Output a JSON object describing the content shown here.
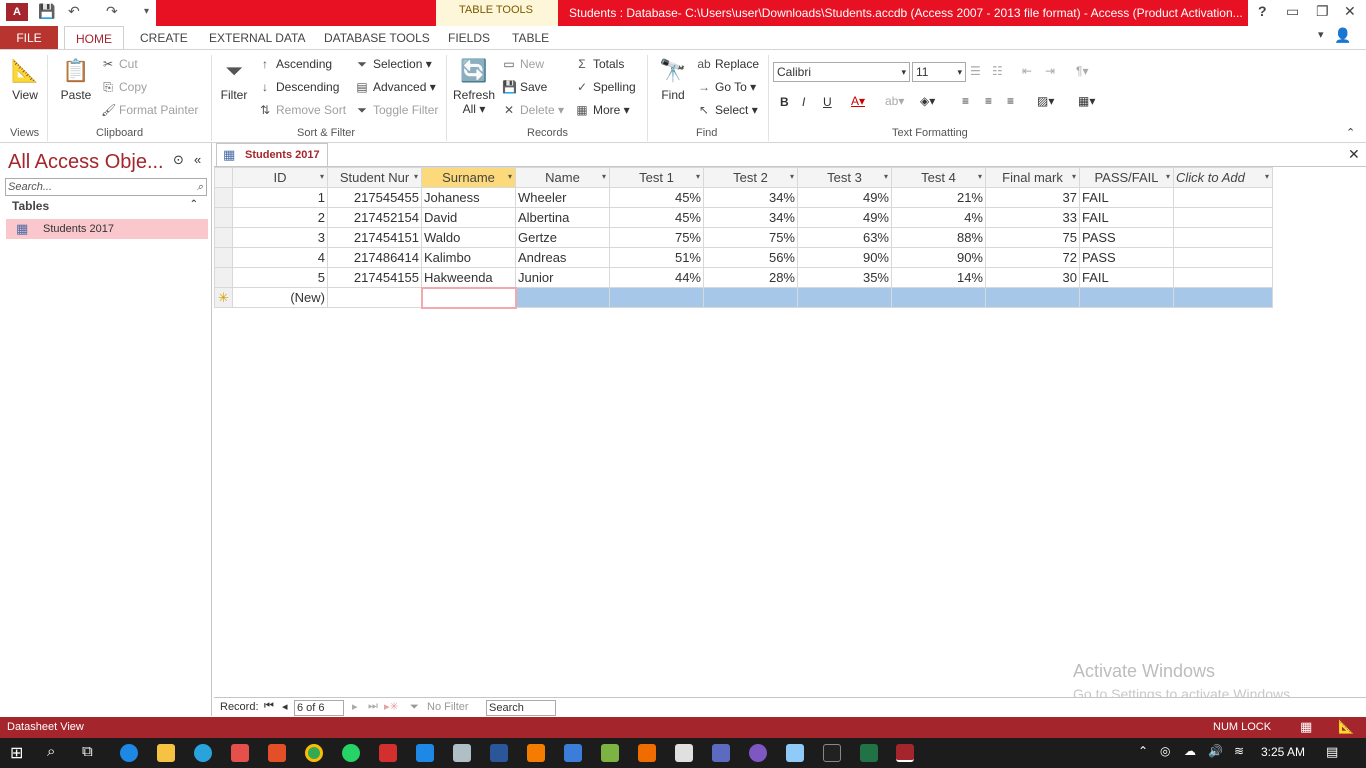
{
  "window": {
    "title": "Students : Database- C:\\Users\\user\\Downloads\\Students.accdb (Access 2007 - 2013 file format) -  Access (Product Activation...",
    "context_tab_group": "TABLE TOOLS",
    "help": "?"
  },
  "ribbon_tabs": {
    "file": "FILE",
    "home": "HOME",
    "create": "CREATE",
    "external_data": "EXTERNAL DATA",
    "database_tools": "DATABASE TOOLS",
    "fields": "FIELDS",
    "table": "TABLE"
  },
  "ribbon": {
    "views": {
      "view": "View",
      "group": "Views"
    },
    "clipboard": {
      "paste": "Paste",
      "cut": "Cut",
      "copy": "Copy",
      "format_painter": "Format Painter",
      "group": "Clipboard"
    },
    "sort_filter": {
      "filter": "Filter",
      "ascending": "Ascending",
      "descending": "Descending",
      "remove_sort": "Remove Sort",
      "selection": "Selection",
      "advanced": "Advanced",
      "toggle_filter": "Toggle Filter",
      "group": "Sort & Filter"
    },
    "records": {
      "refresh": "Refresh",
      "refresh_all": "All",
      "new": "New",
      "save": "Save",
      "delete": "Delete",
      "totals": "Totals",
      "spelling": "Spelling",
      "more": "More",
      "group": "Records"
    },
    "find": {
      "find": "Find",
      "replace": "Replace",
      "go_to": "Go To",
      "select": "Select",
      "group": "Find"
    },
    "text_formatting": {
      "font": "Calibri",
      "size": "11",
      "bold": "B",
      "italic": "I",
      "underline": "U",
      "group": "Text Formatting"
    }
  },
  "nav": {
    "title": "All Access Obje...",
    "search_placeholder": "Search...",
    "section": "Tables",
    "items": [
      "Students 2017"
    ]
  },
  "document_tab": "Students 2017",
  "grid": {
    "columns": [
      "ID",
      "Student Nur",
      "Surname",
      "Name",
      "Test 1",
      "Test 2",
      "Test 3",
      "Test 4",
      "Final mark",
      "PASS/FAIL",
      "Click to Add"
    ],
    "rows": [
      [
        "1",
        "217545455",
        "Johaness",
        "Wheeler",
        "45%",
        "34%",
        "49%",
        "21%",
        "37",
        "FAIL"
      ],
      [
        "2",
        "217452154",
        "David",
        "Albertina",
        "45%",
        "34%",
        "49%",
        "4%",
        "33",
        "FAIL"
      ],
      [
        "3",
        "217454151",
        "Waldo",
        "Gertze",
        "75%",
        "75%",
        "63%",
        "88%",
        "75",
        "PASS"
      ],
      [
        "4",
        "217486414",
        "Kalimbo",
        "Andreas",
        "51%",
        "56%",
        "90%",
        "90%",
        "72",
        "PASS"
      ],
      [
        "5",
        "217454155",
        "Hakweenda",
        "Junior",
        "44%",
        "28%",
        "35%",
        "14%",
        "30",
        "FAIL"
      ]
    ],
    "new_row_label": "(New)",
    "new_row_marker": "✳"
  },
  "record_bar": {
    "label": "Record:",
    "position": "6 of 6",
    "filter": "No Filter",
    "search": "Search"
  },
  "status": {
    "view": "Datasheet View",
    "num_lock": "NUM LOCK"
  },
  "watermark": {
    "line1": "Activate Windows",
    "line2": "Go to Settings to activate Windows."
  },
  "taskbar": {
    "time": "3:25 AM"
  },
  "colors": {
    "accent": "#a4262c",
    "title_red": "#e81123",
    "selected_row": "#a6c7e7"
  }
}
